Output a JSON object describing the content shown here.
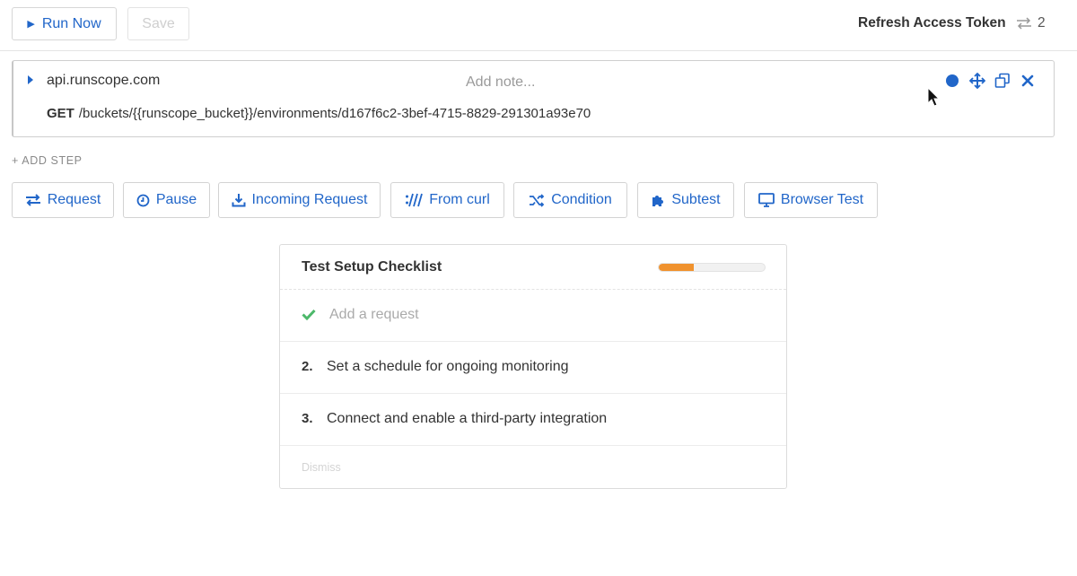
{
  "toolbar": {
    "run_label": "Run Now",
    "save_label": "Save",
    "title": "Refresh Access Token",
    "count": "2"
  },
  "step": {
    "host": "api.runscope.com",
    "note_placeholder": "Add note...",
    "method": "GET",
    "path": "/buckets/{{runscope_bucket}}/environments/d167f6c2-3bef-4715-8829-291301a93e70"
  },
  "add_step_label": "+ ADD STEP",
  "step_types": [
    {
      "label": "Request"
    },
    {
      "label": "Pause"
    },
    {
      "label": "Incoming Request"
    },
    {
      "label": "From curl"
    },
    {
      "label": "Condition"
    },
    {
      "label": "Subtest"
    },
    {
      "label": "Browser Test"
    }
  ],
  "checklist": {
    "title": "Test Setup Checklist",
    "progress": 0.33,
    "items": [
      {
        "num": "",
        "text": "Add a request",
        "done": true
      },
      {
        "num": "2.",
        "text": "Set a schedule for ongoing monitoring",
        "done": false
      },
      {
        "num": "3.",
        "text": "Connect and enable a third-party integration",
        "done": false
      }
    ],
    "dismiss_label": "Dismiss"
  },
  "colors": {
    "accent": "#2166c9",
    "progress": "#f0922e",
    "check": "#4cb86a"
  }
}
